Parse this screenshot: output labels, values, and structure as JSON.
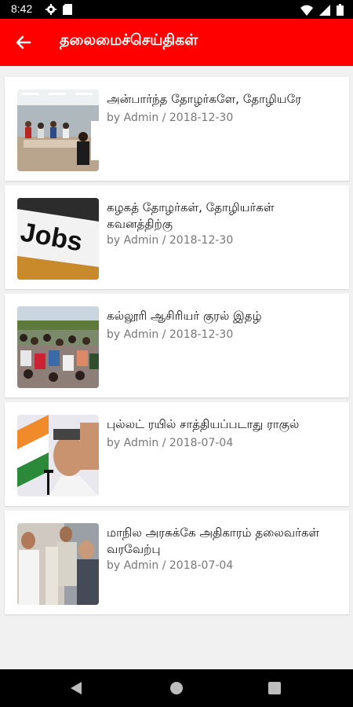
{
  "status_bar": {
    "time": "8:42"
  },
  "app_bar": {
    "title": "தலைமைச்செய்திகள்"
  },
  "articles": [
    {
      "title": "அன்பார்ந்த தோழர்களே, தோழியரே",
      "author": "by Admin",
      "date": "2018-12-30",
      "thumbnail": "meeting-room-photo"
    },
    {
      "title": "கழகத் தோழர்கள், தோழியர்கள் கவனத்திற்கு",
      "author": "by Admin",
      "date": "2018-12-30",
      "thumbnail": "jobs-sign-photo",
      "thumb_text": "Jobs"
    },
    {
      "title": "கல்லூரி ஆசிரியர் குரல் இதழ்",
      "author": "by Admin",
      "date": "2018-12-30",
      "thumbnail": "crowd-protest-photo"
    },
    {
      "title": "புல்லட் ரயில் சாத்தியப்படாது ராகுல்",
      "author": "by Admin",
      "date": "2018-07-04",
      "thumbnail": "rahul-speech-photo"
    },
    {
      "title": "மாநில அரசுக்கே அதிகாரம் தலைவர்கள் வரவேற்பு",
      "author": "by Admin",
      "date": "2018-07-04",
      "thumbnail": "leaders-photo"
    }
  ],
  "colors": {
    "app_bar": "#fe0000",
    "background": "#f1f1f1",
    "meta_text": "#777777"
  },
  "icons": [
    "back-arrow-icon",
    "settings-icon",
    "sd-card-icon",
    "wifi-icon",
    "signal-icon",
    "battery-icon",
    "nav-back-icon",
    "nav-home-icon",
    "nav-recents-icon"
  ]
}
